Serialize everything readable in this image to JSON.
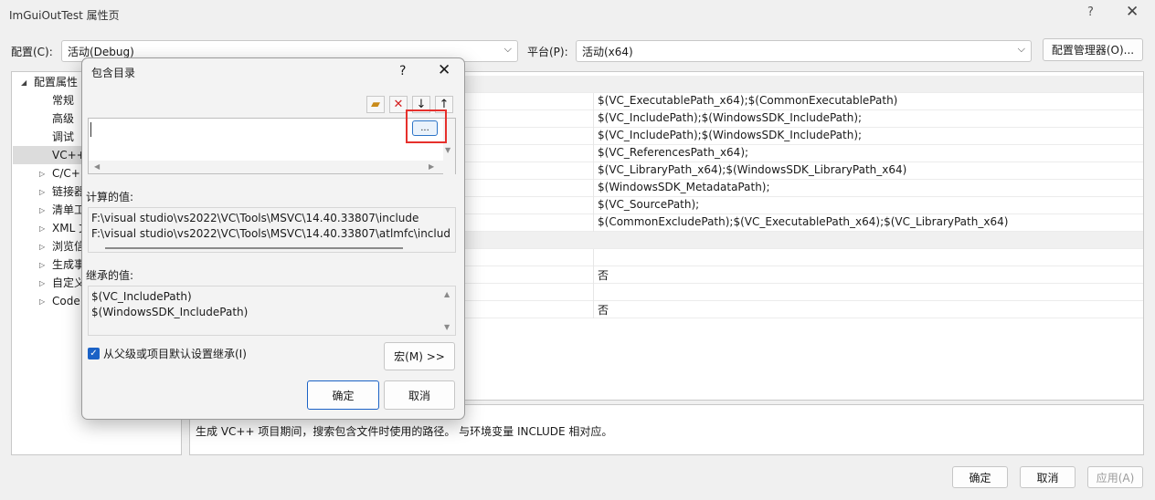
{
  "window": {
    "title": "ImGuiOutTest 属性页",
    "help": "?",
    "close": "✕"
  },
  "config": {
    "config_label": "配置(C):",
    "config_value": "活动(Debug)",
    "platform_label": "平台(P):",
    "platform_value": "活动(x64)",
    "manager_button": "配置管理器(O)..."
  },
  "tree": {
    "root": "配置属性",
    "items": [
      "常规",
      "高级",
      "调试",
      "VC++",
      "C/C+",
      "链接器",
      "清单工",
      "XML 文",
      "浏览信",
      "生成事",
      "自定义",
      "Code"
    ]
  },
  "grid": {
    "values": [
      "$(VC_ExecutablePath_x64);$(CommonExecutablePath)",
      "$(VC_IncludePath);$(WindowsSDK_IncludePath);",
      "$(VC_IncludePath);$(WindowsSDK_IncludePath);",
      "$(VC_ReferencesPath_x64);",
      "$(VC_LibraryPath_x64);$(WindowsSDK_LibraryPath_x64)",
      "$(WindowsSDK_MetadataPath);",
      "$(VC_SourcePath);",
      "$(CommonExcludePath);$(VC_ExecutablePath_x64);$(VC_LibraryPath_x64)",
      "",
      "",
      "否",
      "",
      "否"
    ]
  },
  "description": "生成 VC++ 项目期间，搜索包含文件时使用的路径。 与环境变量 INCLUDE 相对应。",
  "buttons": {
    "ok": "确定",
    "cancel": "取消",
    "apply": "应用(A)"
  },
  "dialog": {
    "title": "包含目录",
    "help": "?",
    "close": "✕",
    "toolbar_icons": [
      "new-folder-icon",
      "delete-icon",
      "move-down-icon",
      "move-up-icon"
    ],
    "edit_value": "",
    "ellipsis": "...",
    "computed_label": "计算的值:",
    "computed": [
      "F:\\visual studio\\vs2022\\VC\\Tools\\MSVC\\14.40.33807\\include",
      "F:\\visual studio\\vs2022\\VC\\Tools\\MSVC\\14.40.33807\\atlmfc\\includ"
    ],
    "inherited_label": "继承的值:",
    "inherited": [
      "$(VC_IncludePath)",
      "$(WindowsSDK_IncludePath)"
    ],
    "inherit_checkbox": "从父级或项目默认设置继承(I)",
    "inherit_checked": true,
    "macro_button": "宏(M) >>",
    "ok": "确定",
    "cancel": "取消"
  },
  "colors": {
    "accent": "#1b62c6",
    "highlight": "#e6302c"
  }
}
